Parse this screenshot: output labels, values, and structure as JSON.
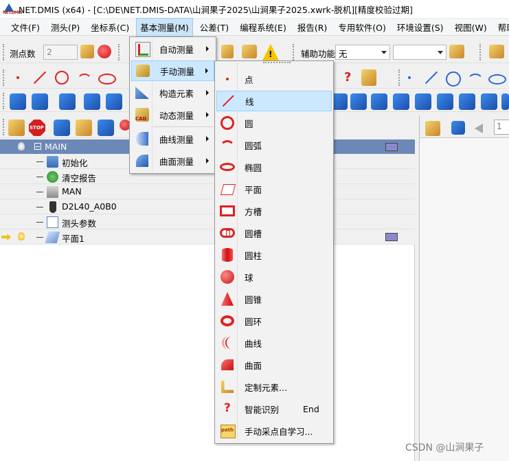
{
  "window": {
    "title": "NET.DMIS (x64) - [C:\\DE\\NET.DMIS-DATA\\山涧果子2025\\山涧果子2025.xwrk-脱机][精度校验过期]",
    "logo_text": "NET.DMIS"
  },
  "menubar": {
    "items": [
      {
        "label": "文件(F)"
      },
      {
        "label": "测头(P)"
      },
      {
        "label": "坐标系(C)"
      },
      {
        "label": "基本测量(M)",
        "active": true
      },
      {
        "label": "公差(T)"
      },
      {
        "label": "编程系统(E)"
      },
      {
        "label": "报告(R)"
      },
      {
        "label": "专用软件(O)"
      },
      {
        "label": "环境设置(S)"
      },
      {
        "label": "视图(W)"
      },
      {
        "label": "帮助(H)"
      }
    ]
  },
  "toolbar": {
    "point_count_label": "测点数",
    "point_count_value": "2",
    "aux_label": "辅助功能",
    "aux_value": "无",
    "second_select_value": "",
    "stop_text": "STOP",
    "path_text": "path",
    "init_text": "Init",
    "rps_text": "RPS",
    "cad_text": "CAD"
  },
  "program_tree": {
    "root_label": "MAIN",
    "nodes": [
      {
        "label": "初始化",
        "icon": "init-icon"
      },
      {
        "label": "清空报告",
        "icon": "clear-report-icon"
      },
      {
        "label": "MAN",
        "icon": "mode-icon"
      },
      {
        "label": "D2L40_A0B0",
        "icon": "probe-icon"
      },
      {
        "label": "测头参数",
        "icon": "probe-params-icon"
      },
      {
        "label": "平面1",
        "icon": "plane-icon",
        "current": true
      }
    ],
    "mode_caption": "Mode",
    "init_caption": "Init"
  },
  "right_panel": {
    "page_field": "1"
  },
  "measure_menu": {
    "items": [
      {
        "label": "自动测量",
        "submenu": true
      },
      {
        "label": "手动测量",
        "submenu": true,
        "highlighted": true
      },
      {
        "label": "构造元素",
        "submenu": true
      },
      {
        "label": "动态测量",
        "submenu": true
      },
      {
        "label": "曲线测量",
        "submenu": true
      },
      {
        "label": "曲面测量",
        "submenu": true
      }
    ]
  },
  "manual_menu": {
    "items": [
      {
        "label": "点",
        "icon": "point-icon"
      },
      {
        "label": "线",
        "icon": "line-icon",
        "highlighted": true
      },
      {
        "label": "圆",
        "icon": "circle-icon"
      },
      {
        "label": "圆弧",
        "icon": "arc-icon"
      },
      {
        "label": "椭圆",
        "icon": "ellipse-icon"
      },
      {
        "label": "平面",
        "icon": "plane-icon"
      },
      {
        "label": "方槽",
        "icon": "rect-slot-icon"
      },
      {
        "label": "圆槽",
        "icon": "round-slot-icon"
      },
      {
        "label": "圆柱",
        "icon": "cylinder-icon"
      },
      {
        "label": "球",
        "icon": "sphere-icon"
      },
      {
        "label": "圆锥",
        "icon": "cone-icon"
      },
      {
        "label": "圆环",
        "icon": "torus-icon"
      },
      {
        "label": "曲线",
        "icon": "curve-icon"
      },
      {
        "label": "曲面",
        "icon": "surface-icon"
      },
      {
        "label": "定制元素...",
        "icon": "custom-feature-icon"
      },
      {
        "label": "智能识别",
        "icon": "smart-recognition-icon",
        "shortcut": "End"
      },
      {
        "label": "手动采点自学习...",
        "icon": "path-learn-icon"
      }
    ]
  },
  "watermark": "CSDN @山涧果子",
  "colors": {
    "tree_header": "#6c88b7",
    "menu_highlight": "#cce8ff",
    "feature_red": "#e02020",
    "toolbar_blue": "#2a6ad0"
  }
}
